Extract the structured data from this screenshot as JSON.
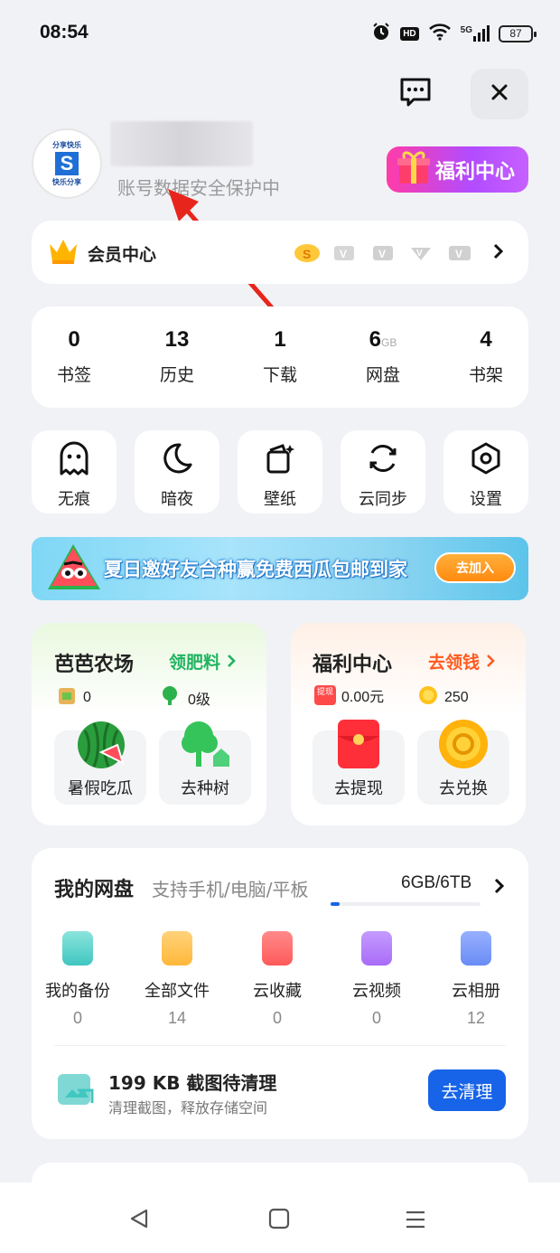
{
  "status": {
    "time": "08:54",
    "hd": "HD",
    "signal": "5G",
    "battery": "87"
  },
  "profile": {
    "avatar_text_top": "分享快乐",
    "avatar_text_bottom": "快乐分享",
    "avatar_letter": "S",
    "subtitle": "账号数据安全保护中",
    "welfare_button": "福利中心"
  },
  "vip": {
    "label": "会员中心"
  },
  "stats": [
    {
      "num": "0",
      "unit": "",
      "label": "书签"
    },
    {
      "num": "13",
      "unit": "",
      "label": "历史"
    },
    {
      "num": "1",
      "unit": "",
      "label": "下载"
    },
    {
      "num": "6",
      "unit": "GB",
      "label": "网盘"
    },
    {
      "num": "4",
      "unit": "",
      "label": "书架"
    }
  ],
  "tools": [
    {
      "label": "无痕",
      "icon": "ghost-icon"
    },
    {
      "label": "暗夜",
      "icon": "moon-icon"
    },
    {
      "label": "壁纸",
      "icon": "wallpaper-icon"
    },
    {
      "label": "云同步",
      "icon": "sync-icon"
    },
    {
      "label": "设置",
      "icon": "settings-icon"
    }
  ],
  "banner": {
    "text": "夏日邀好友合种赢免费西瓜包邮到家",
    "button": "去加入"
  },
  "farm": {
    "title": "芭芭农场",
    "link": "领肥料",
    "fertilizer": "0",
    "level": "0级",
    "tile1": "暑假吃瓜",
    "tile2": "去种树"
  },
  "welfare": {
    "title": "福利中心",
    "link": "去领钱",
    "cash": "0.00元",
    "cash_badge": "提现",
    "coins": "250",
    "tile1": "去提现",
    "tile2": "去兑换"
  },
  "disk": {
    "title": "我的网盘",
    "subtitle": "支持手机/电脑/平板",
    "usage": "6GB/6TB",
    "usage_fraction": 0.001,
    "items": [
      {
        "label": "我的备份",
        "count": "0",
        "color": "#3fc7c0"
      },
      {
        "label": "全部文件",
        "count": "14",
        "color": "#ffb83a"
      },
      {
        "label": "云收藏",
        "count": "0",
        "color": "#ff5a5a"
      },
      {
        "label": "云视频",
        "count": "0",
        "color": "#a86cf7"
      },
      {
        "label": "云相册",
        "count": "12",
        "color": "#6a8cf5"
      }
    ],
    "clean_title": "199 KB 截图待清理",
    "clean_sub": "清理截图，释放存储空间",
    "clean_button": "去清理"
  },
  "colors": {
    "accent_blue": "#1764e8",
    "green": "#1fb35f",
    "orange": "#ff5a1f"
  }
}
